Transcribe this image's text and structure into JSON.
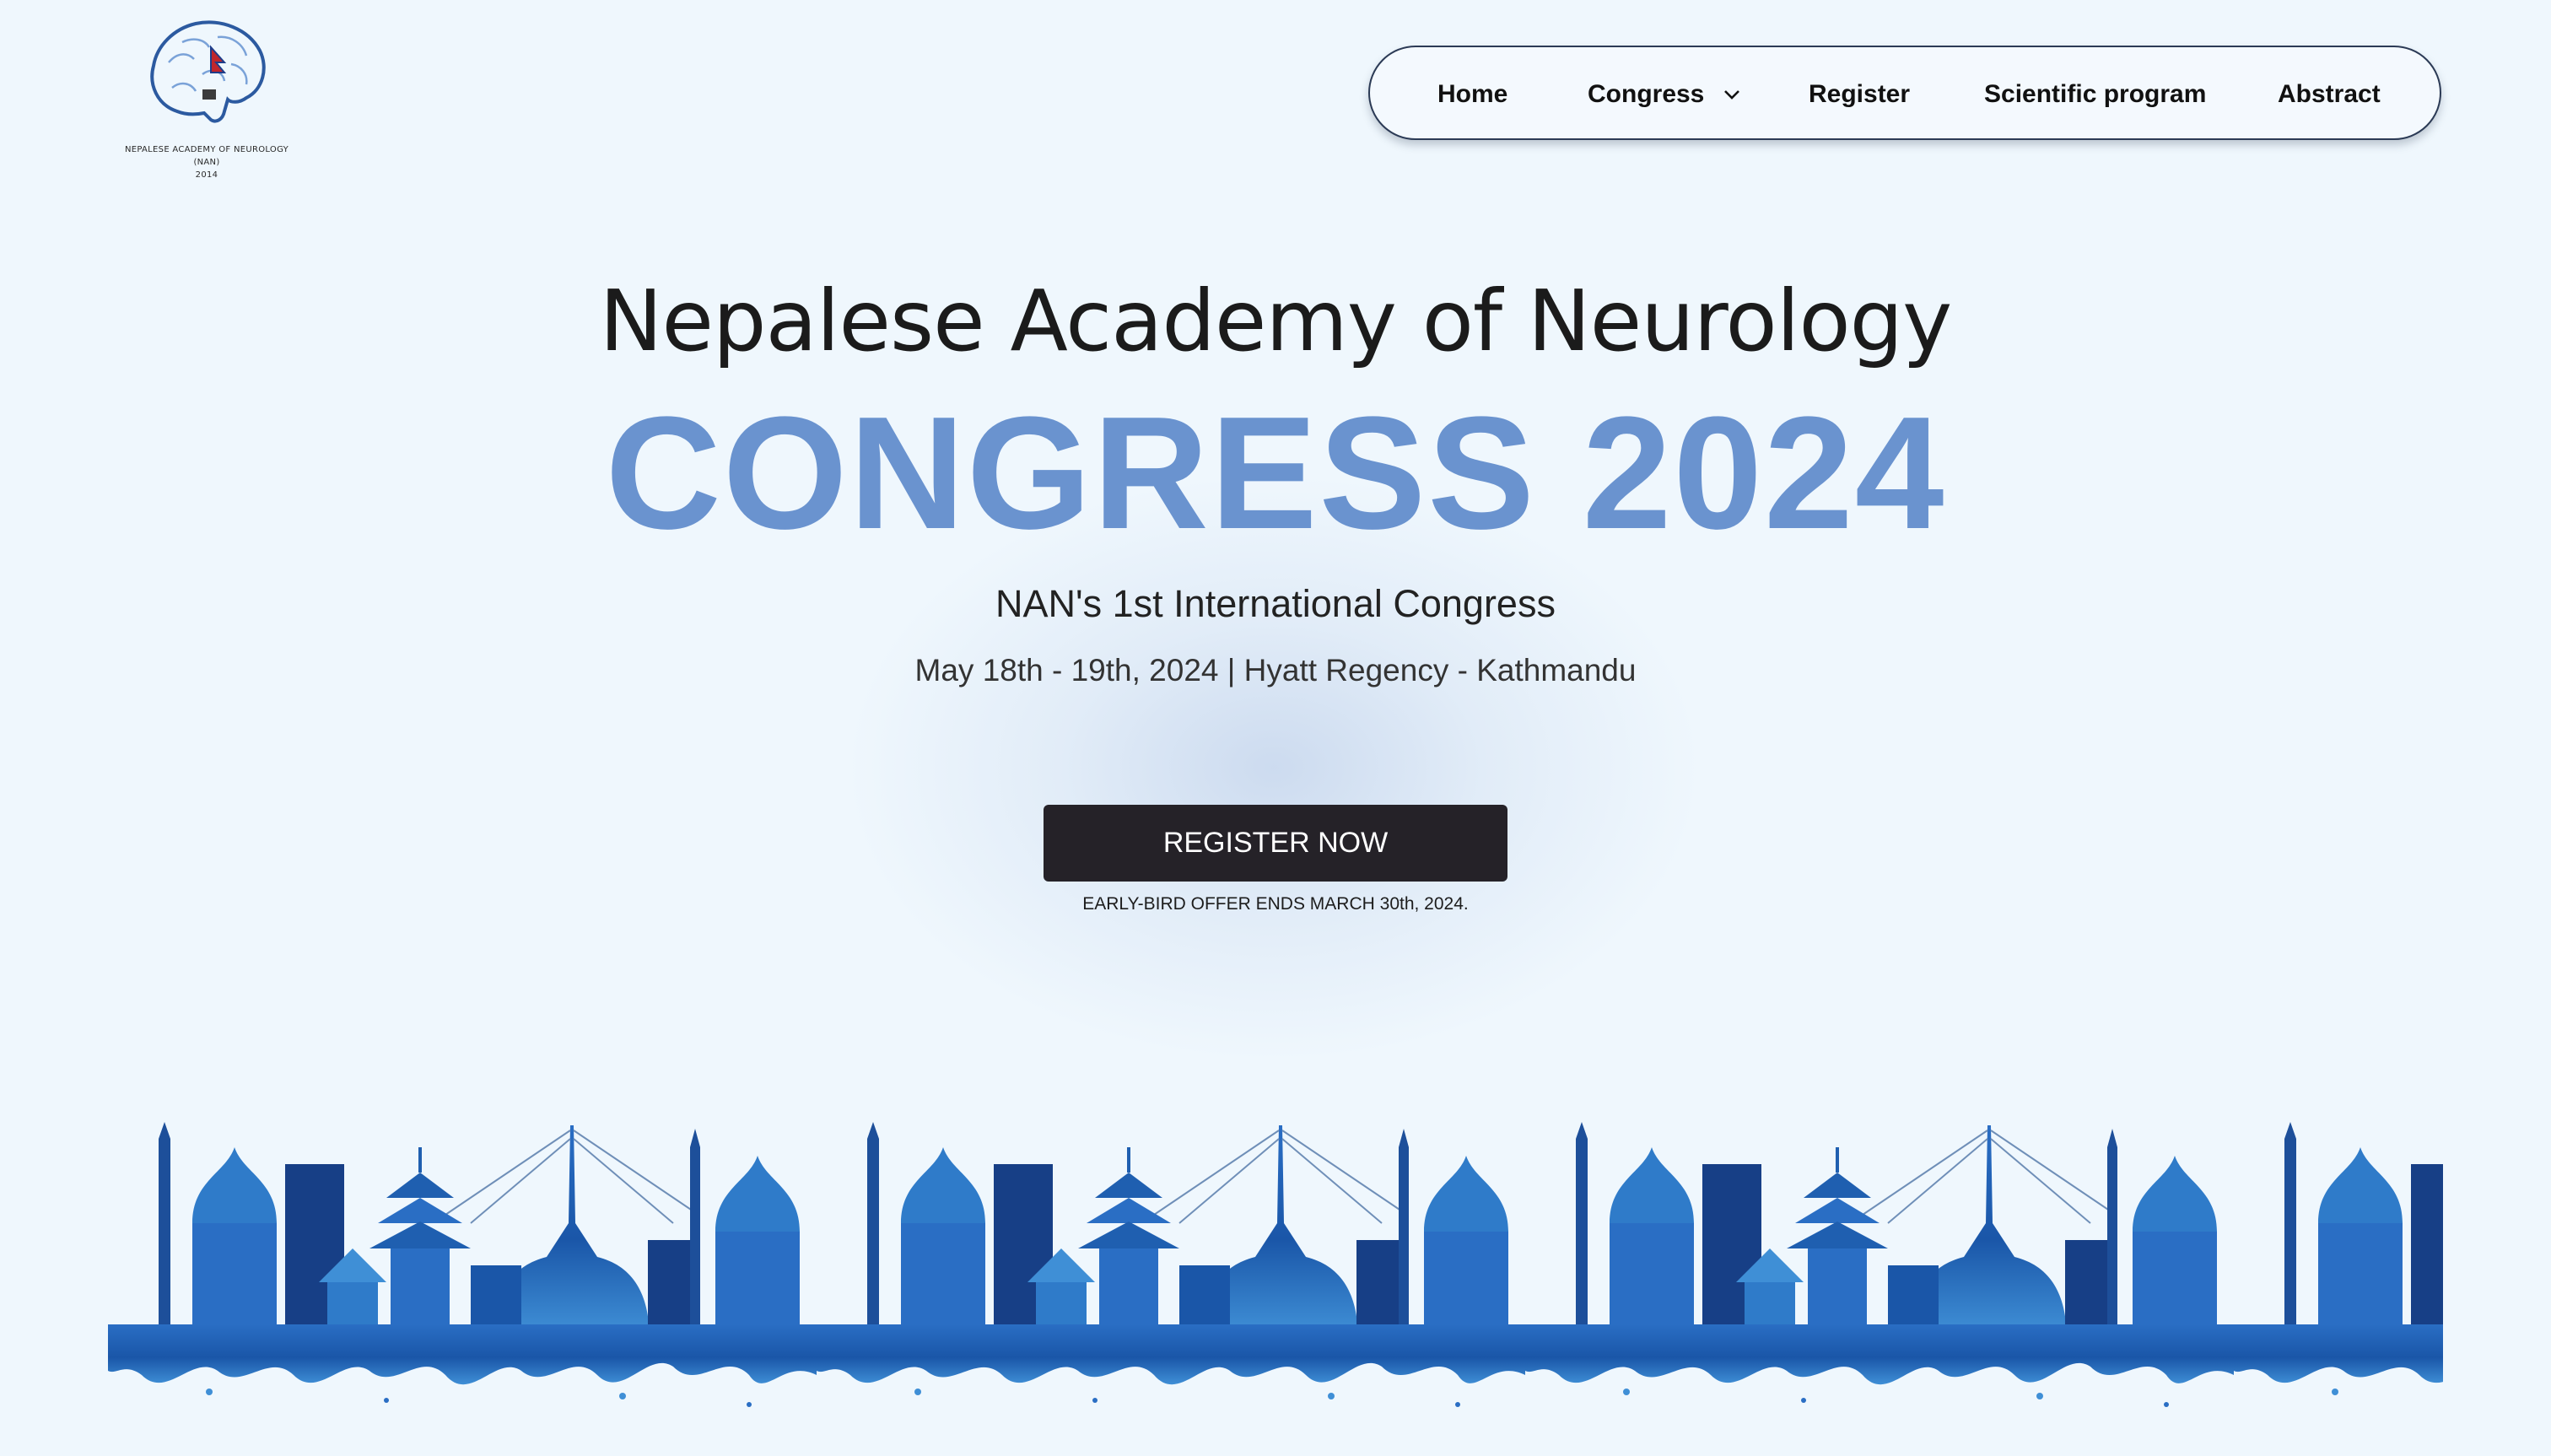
{
  "logo": {
    "name": "NEPALESE ACADEMY OF NEUROLOGY",
    "abbr": "(NAN)",
    "year": "2014"
  },
  "nav": {
    "items": [
      {
        "label": "Home"
      },
      {
        "label": "Congress"
      },
      {
        "label": "Register"
      },
      {
        "label": "Scientific program"
      },
      {
        "label": "Abstract"
      }
    ],
    "icons": {
      "congress_dropdown": "chevron-down-icon"
    }
  },
  "hero": {
    "subtitle": "Nepalese Academy of Neurology",
    "title": "CONGRESS 2024",
    "tagline": "NAN's 1st International Congress",
    "date_venue": "May 18th - 19th, 2024 | Hyatt Regency - Kathmandu"
  },
  "cta": {
    "label": "REGISTER NOW",
    "note": "EARLY-BIRD OFFER ENDS MARCH 30th, 2024."
  },
  "colors": {
    "background": "#eff7fd",
    "title_blue": "#6a93cf",
    "button_dark": "#252228",
    "nav_border": "#2b3a55",
    "skyline_blue": "#1f5fb0"
  }
}
